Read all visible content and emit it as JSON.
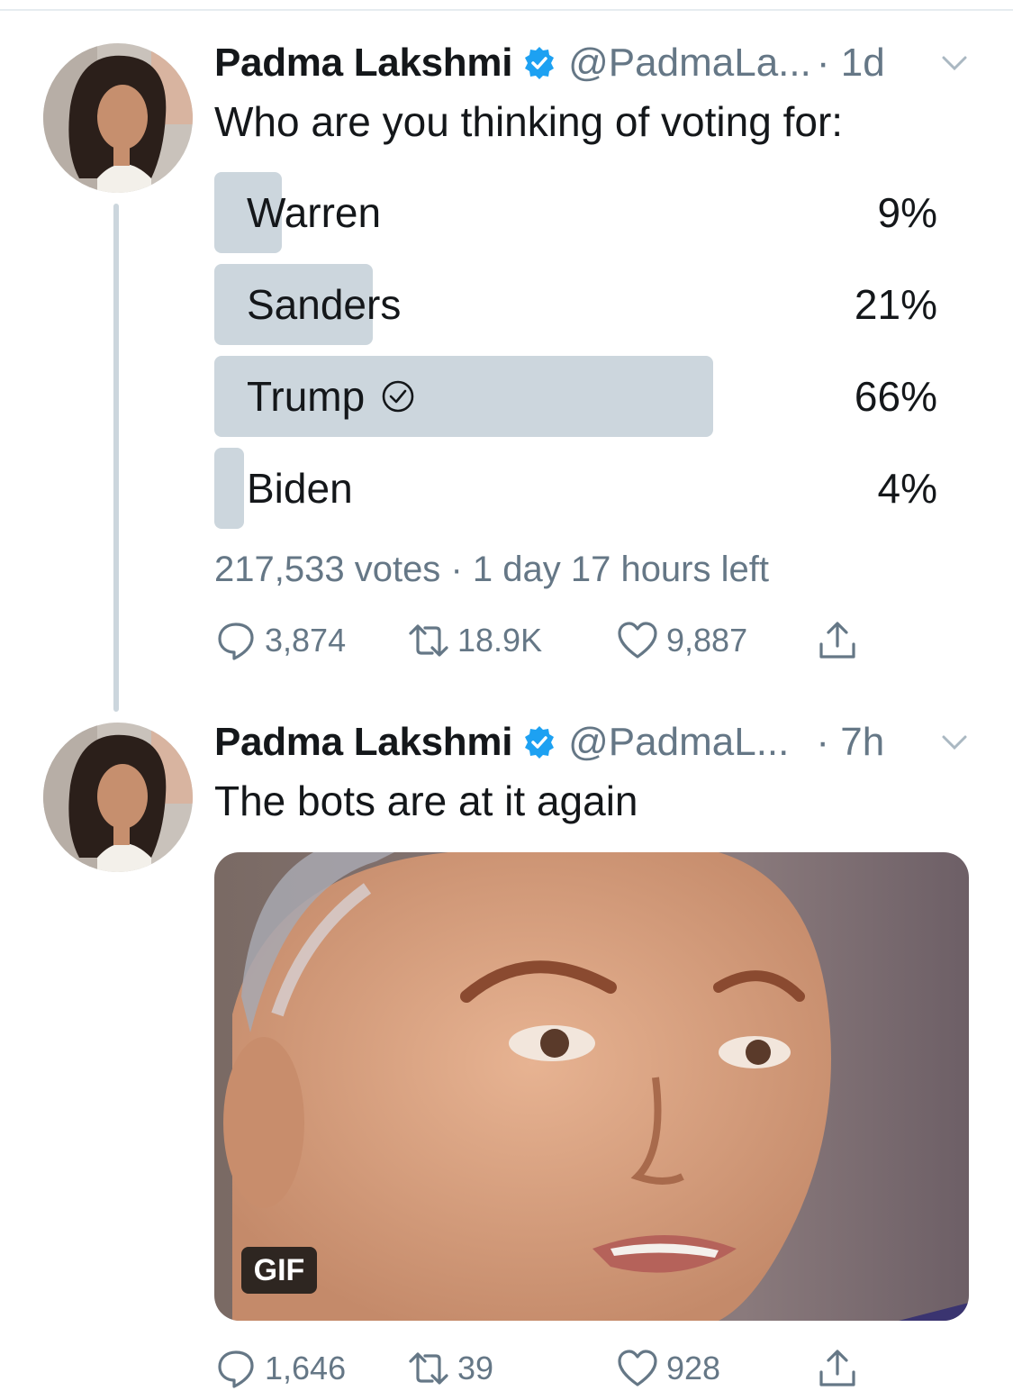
{
  "tweets": [
    {
      "author": "Padma Lakshmi",
      "handle": "@PadmaLa...",
      "time": "· 1d",
      "text": "Who are you thinking of voting for:",
      "poll": {
        "options": [
          {
            "label": "Warren",
            "percent_text": "9%",
            "percent": 9,
            "selected": false
          },
          {
            "label": "Sanders",
            "percent_text": "21%",
            "percent": 21,
            "selected": false
          },
          {
            "label": "Trump",
            "percent_text": "66%",
            "percent": 66,
            "selected": true
          },
          {
            "label": "Biden",
            "percent_text": "4%",
            "percent": 4,
            "selected": false
          }
        ],
        "votes": "217,533 votes",
        "time_left": "· 1 day 17 hours left"
      },
      "actions": {
        "replies": "3,874",
        "retweets": "18.9K",
        "likes": "9,887"
      }
    },
    {
      "author": "Padma Lakshmi",
      "handle": "@PadmaL...",
      "time": "· 7h",
      "text": "The bots are at it again",
      "media_badge": "GIF",
      "actions": {
        "replies": "1,646",
        "retweets": "39",
        "likes": "928"
      }
    }
  ],
  "colors": {
    "verified": "#1da1f2",
    "poll_bar": "#ccd6dd",
    "muted_text": "#657786",
    "primary_text": "#14171a"
  },
  "icons": [
    "verified-badge-icon",
    "chevron-down-icon",
    "check-circle-icon",
    "reply-icon",
    "retweet-icon",
    "like-icon",
    "share-icon"
  ]
}
